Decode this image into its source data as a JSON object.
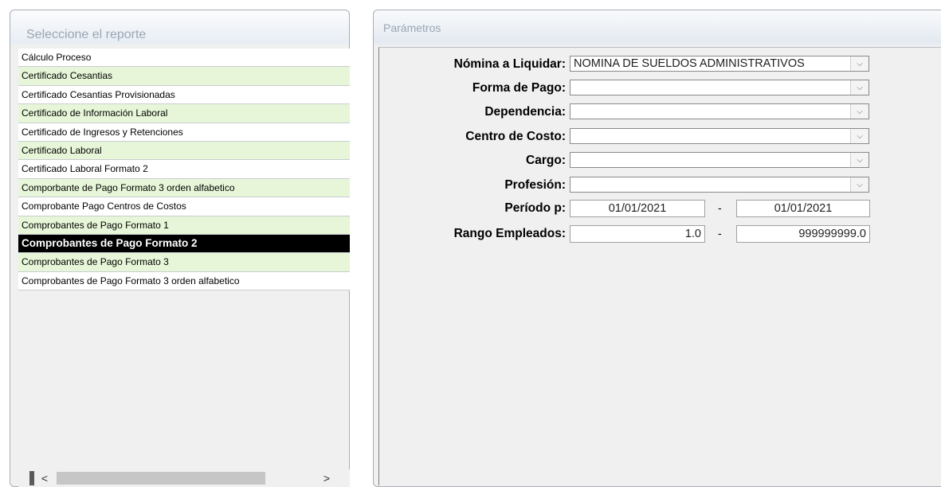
{
  "left_panel": {
    "title": "Seleccione el reporte",
    "reports": [
      "Cálculo Proceso",
      "Certificado Cesantias",
      "Certificado Cesantias Provisionadas",
      "Certificado de Información Laboral",
      "Certificado de Ingresos y Retenciones",
      "Certificado Laboral",
      "Certificado Laboral Formato 2",
      "Comporbante de Pago Formato 3 orden alfabetico",
      "Comprobante Pago Centros de Costos",
      "Comprobantes de Pago Formato 1",
      "Comprobantes de Pago Formato 2",
      "Comprobantes de Pago Formato 3",
      "Comprobantes de Pago Formato 3 orden alfabetico"
    ],
    "selected_index": 10,
    "scrollbar": {
      "left_arrow": "<",
      "right_arrow": ">"
    }
  },
  "right_panel": {
    "title": "Parámetros",
    "fields": {
      "nomina": {
        "label": "Nómina a Liquidar:",
        "value": "NOMINA DE SUELDOS ADMINISTRATIVOS"
      },
      "forma_pago": {
        "label": "Forma de Pago:",
        "value": ""
      },
      "dependencia": {
        "label": "Dependencia:",
        "value": ""
      },
      "centro_costo": {
        "label": "Centro de Costo:",
        "value": ""
      },
      "cargo": {
        "label": "Cargo:",
        "value": ""
      },
      "profesion": {
        "label": "Profesión:",
        "value": ""
      },
      "periodo": {
        "label": "Período p:",
        "from": "01/01/2021",
        "separator": "-",
        "to": "01/01/2021"
      },
      "rango": {
        "label": "Rango Empleados:",
        "from": "1.0",
        "separator": "-",
        "to": "999999999.0"
      }
    },
    "dropdown_glyph": "⌵"
  },
  "colors": {
    "selected_bg": "#000000",
    "alt_row_bg": "#e7f6d8",
    "title_text": "#9aa6b4"
  }
}
